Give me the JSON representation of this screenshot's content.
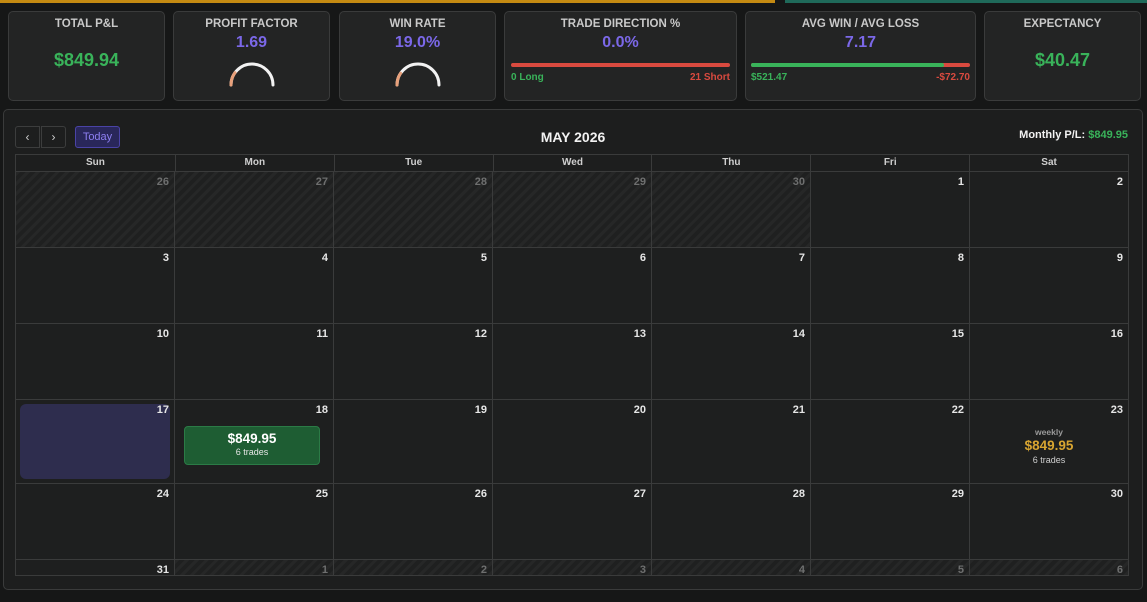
{
  "stats": {
    "total_pnl": {
      "title": "TOTAL P&L",
      "value": "$849.94"
    },
    "profit_factor": {
      "title": "PROFIT FACTOR",
      "value": "1.69",
      "gauge_fraction": 0.2
    },
    "win_rate": {
      "title": "WIN RATE",
      "value": "19.0%",
      "gauge_fraction": 0.19
    },
    "trade_direction": {
      "title": "TRADE DIRECTION %",
      "value": "0.0%",
      "long_label": "0 Long",
      "short_label": "21 Short"
    },
    "avg_win_loss": {
      "title": "AVG WIN / AVG LOSS",
      "value": "7.17",
      "win_label": "$521.47",
      "loss_label": "-$72.70",
      "win_fraction": 0.88
    },
    "expectancy": {
      "title": "EXPECTANCY",
      "value": "$40.47"
    }
  },
  "calendar": {
    "prev_icon": "chevron-left-icon",
    "next_icon": "chevron-right-icon",
    "prev_glyph": "‹",
    "next_glyph": "›",
    "today_label": "Today",
    "title": "MAY 2026",
    "monthly_label": "Monthly P/L:",
    "monthly_value": "$849.95",
    "days_of_week": [
      "Sun",
      "Mon",
      "Tue",
      "Wed",
      "Thu",
      "Fri",
      "Sat"
    ],
    "weeks": [
      [
        {
          "d": "26",
          "o": true
        },
        {
          "d": "27",
          "o": true
        },
        {
          "d": "28",
          "o": true
        },
        {
          "d": "29",
          "o": true
        },
        {
          "d": "30",
          "o": true
        },
        {
          "d": "1"
        },
        {
          "d": "2"
        }
      ],
      [
        {
          "d": "3"
        },
        {
          "d": "4"
        },
        {
          "d": "5"
        },
        {
          "d": "6"
        },
        {
          "d": "7"
        },
        {
          "d": "8"
        },
        {
          "d": "9"
        }
      ],
      [
        {
          "d": "10"
        },
        {
          "d": "11"
        },
        {
          "d": "12"
        },
        {
          "d": "13"
        },
        {
          "d": "14"
        },
        {
          "d": "15"
        },
        {
          "d": "16"
        }
      ],
      [
        {
          "d": "17",
          "today": true
        },
        {
          "d": "18",
          "pnl": "$849.95",
          "trades": "6 trades"
        },
        {
          "d": "19"
        },
        {
          "d": "20"
        },
        {
          "d": "21"
        },
        {
          "d": "22"
        },
        {
          "d": "23",
          "weekly_label": "weekly",
          "weekly_pnl": "$849.95",
          "weekly_trades": "6 trades"
        }
      ],
      [
        {
          "d": "24"
        },
        {
          "d": "25"
        },
        {
          "d": "26"
        },
        {
          "d": "27"
        },
        {
          "d": "28"
        },
        {
          "d": "29"
        },
        {
          "d": "30"
        }
      ],
      [
        {
          "d": "31"
        },
        {
          "d": "1",
          "o": true
        },
        {
          "d": "2",
          "o": true
        },
        {
          "d": "3",
          "o": true
        },
        {
          "d": "4",
          "o": true
        },
        {
          "d": "5",
          "o": true
        },
        {
          "d": "6",
          "o": true
        }
      ]
    ]
  },
  "colors": {
    "green": "#39b35a",
    "red": "#d94a3f",
    "purple": "#7b68e8",
    "gold": "#d8a531",
    "gauge_fill": "#e8a07a",
    "gauge_track": "#f2f2f2"
  }
}
